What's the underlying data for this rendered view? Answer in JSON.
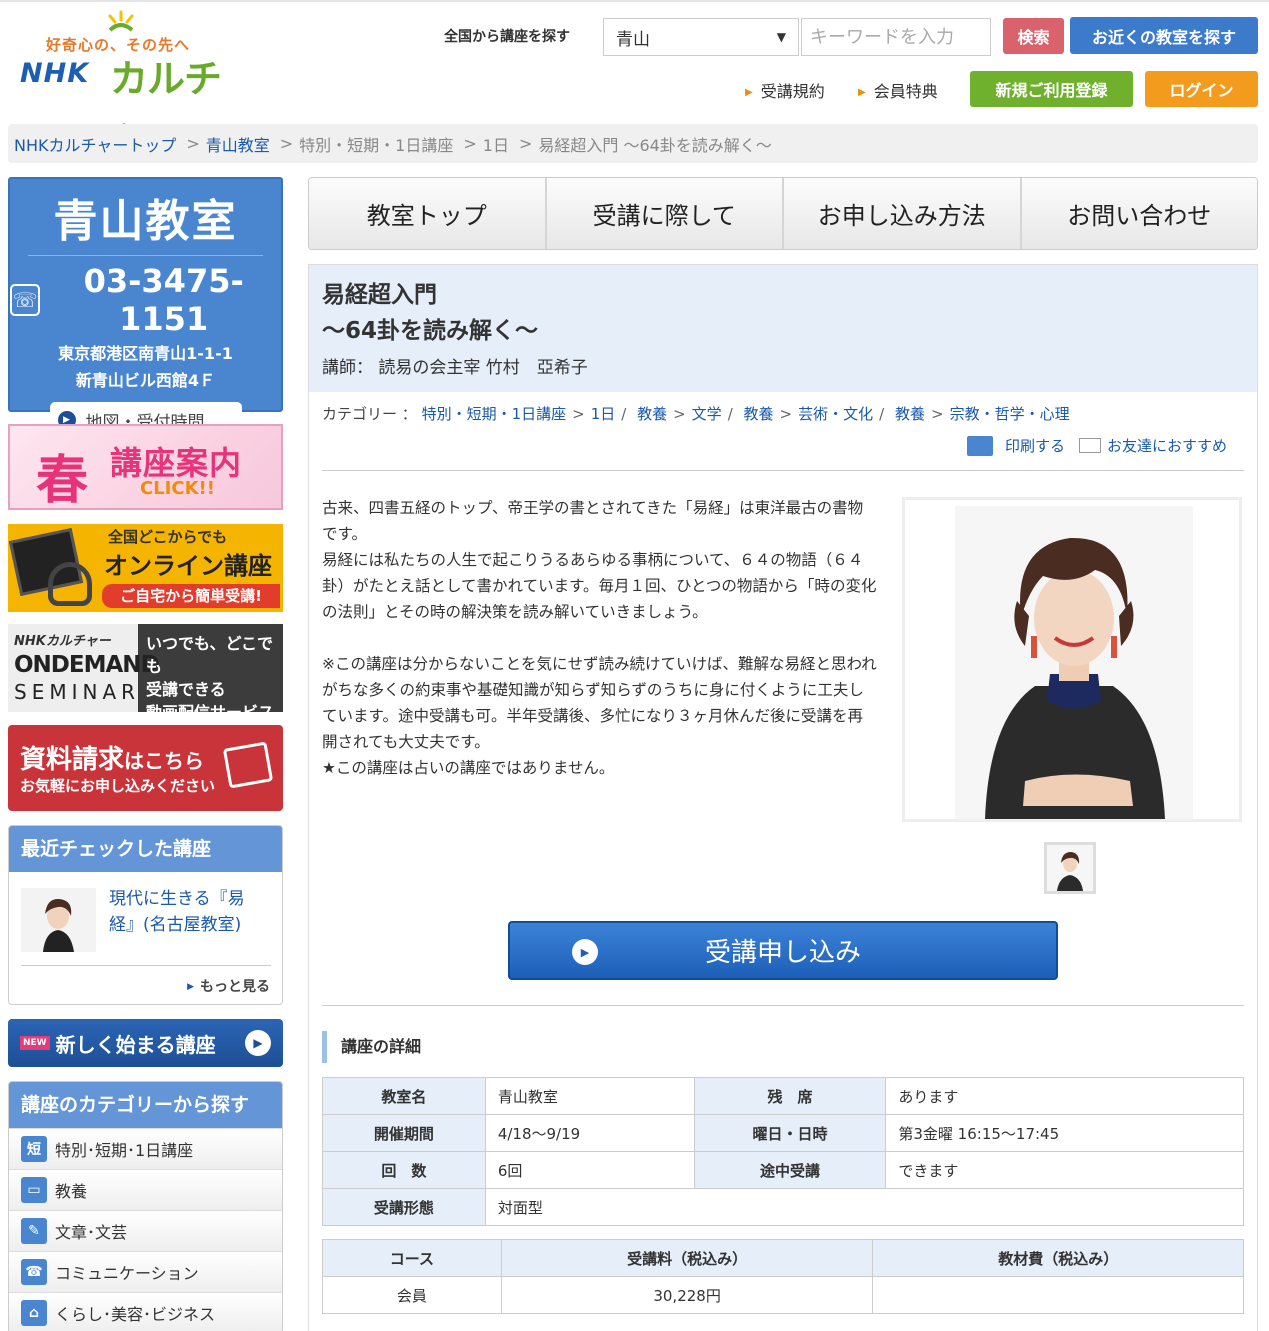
{
  "header": {
    "logo_tagline": "好奇心の、その先へ",
    "logo_nhk": "NHK",
    "logo_culture": "カルチャー",
    "search_label": "全国から講座を探す",
    "search_select_value": "青山",
    "search_placeholder": "キーワードを入力",
    "search_button": "検索",
    "near_button": "お近くの教室を探す",
    "links": [
      "受講規約",
      "会員特典"
    ],
    "register_button": "新規ご利用登録",
    "login_button": "ログイン"
  },
  "breadcrumb": [
    "NHKカルチャートップ",
    "青山教室",
    "特別・短期・1日講座",
    "1日",
    "易経超入門 ～64卦を読み解く～"
  ],
  "sidebar": {
    "school_name": "青山教室",
    "tel": "03-3475-1151",
    "address_line1": "東京都港区南青山1-1-1",
    "address_line2": "新青山ビル西館4Ｆ",
    "map_button": "地図・受付時間",
    "spring_banner": {
      "big": "春",
      "title": "講座案内",
      "click": "CLICK!!"
    },
    "online_banner": {
      "line1": "全国どこからでも",
      "line2": "オンライン講座",
      "line3": "ご自宅から簡単受講!"
    },
    "ondemand_banner": {
      "nhk": "NHKカルチャー",
      "line1": "ONDEMAND",
      "line2": "SEMINAR",
      "right1": "いつでも、どこでも",
      "right2": "受講できる",
      "right3": "動画配信サービス"
    },
    "request_banner": {
      "title_main": "資料請求",
      "title_suffix": "はこちら",
      "sub": "お気軽にお申し込みください"
    },
    "recent": {
      "title": "最近チェックした講座",
      "item": "現代に生きる『易経』(名古屋教室)",
      "more": "もっと見る"
    },
    "new_course": {
      "tag": "NEW",
      "label": "新しく始まる講座"
    },
    "categories": {
      "title": "講座のカテゴリーから探す",
      "items": [
        {
          "icon": "短",
          "label": "特別･短期･1日講座"
        },
        {
          "icon": "▭",
          "label": "教養"
        },
        {
          "icon": "✎",
          "label": "文章･文芸"
        },
        {
          "icon": "☎",
          "label": "コミュニケーション"
        },
        {
          "icon": "⌂",
          "label": "くらし･美容･ビジネス"
        }
      ]
    }
  },
  "tabs": [
    "教室トップ",
    "受講に際して",
    "お申し込み方法",
    "お問い合わせ"
  ],
  "course": {
    "title_line1": "易経超入門",
    "title_line2": "～64卦を読み解く～",
    "teacher": "講師：  読易の会主宰 竹村　亞希子",
    "category_label": "カテゴリー ：",
    "categories": [
      {
        "a": "特別・短期・1日講座",
        "b": "1日"
      },
      {
        "a": "教養",
        "b": "文学"
      },
      {
        "a": "教養",
        "b": "芸術・文化"
      },
      {
        "a": "教養",
        "b": "宗教・哲学・心理"
      }
    ],
    "print": "印刷する",
    "recommend": "お友達におすすめ",
    "desc_p1": "古来、四書五経のトップ、帝王学の書とされてきた「易経」は東洋最古の書物です。",
    "desc_p2": "易経には私たちの人生で起こりうるあらゆる事柄について、６４の物語（６４卦）がたとえ話として書かれています。毎月１回、ひとつの物語から「時の変化の法則」とその時の解決策を読み解いていきましょう。",
    "desc_p3": "※この講座は分からないことを気にせず読み続けていけば、難解な易経と思われがちな多くの約束事や基礎知識が知らず知らずのうちに身に付くように工夫しています。途中受講も可。半年受講後、多忙になり３ヶ月休んだ後に受講を再開されても大丈夫です。",
    "desc_p4": "★この講座は占いの講座ではありません。",
    "apply_button": "受講申し込み",
    "detail_heading": "講座の詳細",
    "details": {
      "room_label": "教室名",
      "room": "青山教室",
      "seats_label": "残　席",
      "seats": "あります",
      "period_label": "開催期間",
      "period": "4/18～9/19",
      "day_label": "曜日・日時",
      "day": "第3金曜 16:15～17:45",
      "count_label": "回　数",
      "count": "6回",
      "midjoin_label": "途中受講",
      "midjoin": "できます",
      "format_label": "受講形態",
      "format": "対面型"
    },
    "fees": {
      "headers": [
        "コース",
        "受講料（税込み）",
        "教材費（税込み）"
      ],
      "rows": [
        [
          "会員",
          "30,228円",
          ""
        ]
      ]
    }
  }
}
